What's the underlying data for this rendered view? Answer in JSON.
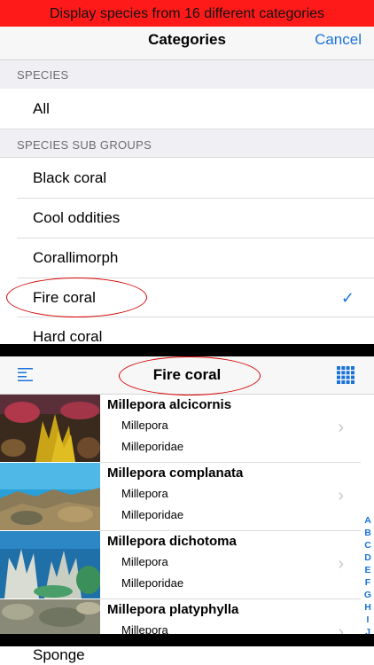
{
  "banner": {
    "text": "Display species from 16 different categories"
  },
  "categories_nav": {
    "title": "Categories",
    "cancel": "Cancel"
  },
  "sections": {
    "species_header": "SPECIES",
    "all_label": "All",
    "subgroups_header": "SPECIES SUB GROUPS"
  },
  "subgroups": [
    {
      "label": "Black coral"
    },
    {
      "label": "Cool oddities"
    },
    {
      "label": "Corallimorph"
    },
    {
      "label": "Fire coral",
      "selected": true
    },
    {
      "label": "Hard coral"
    }
  ],
  "list_nav": {
    "title": "Fire coral",
    "menu_icon": "list-menu-icon",
    "grid_icon": "grid-icon"
  },
  "species": [
    {
      "name": "Millepora alcicornis",
      "genus": "Millepora",
      "family": "Milleporidae"
    },
    {
      "name": "Millepora complanata",
      "genus": "Millepora",
      "family": "Milleporidae"
    },
    {
      "name": "Millepora dichotoma",
      "genus": "Millepora",
      "family": "Milleporidae"
    },
    {
      "name": "Millepora platyphylla",
      "genus": "Millepora"
    }
  ],
  "index_letters": [
    "A",
    "B",
    "C",
    "D",
    "E",
    "F",
    "G",
    "H",
    "I",
    "J"
  ],
  "bottom": {
    "label": "Sponge"
  },
  "colors": {
    "accent": "#1a73d9",
    "banner": "#ff1a1a",
    "annotation": "#d40000"
  }
}
